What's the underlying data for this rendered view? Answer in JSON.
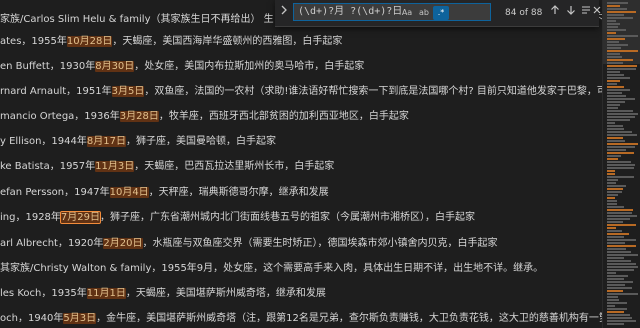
{
  "find_widget": {
    "toggle_icon": "chevron-right-icon",
    "query": "(\\d+)?月 ?(\\d+)?日",
    "match_case_label": "Aa",
    "whole_word_label": "ab",
    "regex_label": ".*",
    "match_count": "84 of 88",
    "prev_icon": "arrow-up-icon",
    "next_icon": "arrow-down-icon",
    "selection_icon": "list-selection-icon",
    "close_icon": "close-icon",
    "accent": "#0e639c"
  },
  "highlight_color": "#613214",
  "lines": [
    {
      "pre": "家族/Carlos Slim Helu & family（其家族生日不再给出） 生日：1940年",
      "hl": "1月28日",
      "post": "，水瓶座：出生地：墨西哥城，白手起家。（注明，下列其他富豪不再"
    },
    {
      "pre": "ates，1955年",
      "hl": "10月28日",
      "post": "，天蝎座，美国西海岸华盛顿州的西雅图，白手起家"
    },
    {
      "pre": "en Buffett，1930年",
      "hl": "8月30日",
      "post": "，处女座，美国内布拉斯加州的奥马哈市，白手起家"
    },
    {
      "pre": "rnard Arnault，1951年",
      "hl": "3月5日",
      "post": "，双鱼座，法国的一农村（求助!谁法语好帮忙搜索一下到底是法国哪个村? 目前只知道他发家于巴黎，可是并不生在巴黎"
    },
    {
      "pre": "mancio Ortega，1936年",
      "hl": "3月28日",
      "post": "，牧羊座，西班牙西北部贫困的加利西亚地区，白手起家"
    },
    {
      "pre": "y Ellison，1944年",
      "hl": "8月17日",
      "post": "，狮子座，美国曼哈顿，白手起家"
    },
    {
      "pre": "ke Batista，1957年",
      "hl": "11月3日",
      "post": "，天蝎座，巴西瓦拉达里斯州长市，白手起家"
    },
    {
      "pre": "efan Persson，1947年",
      "hl": "10月4日",
      "post": "，天秤座，瑞典斯德哥尔摩，继承和发展"
    },
    {
      "pre": "ing，1928年",
      "hl": "7月29日",
      "post": "，狮子座，广东省潮州城内北门街面线巷五号的祖家（今属潮州市湘桥区），白手起家"
    },
    {
      "pre": "arl Albrecht，1920年",
      "hl": "2月20日",
      "post": "，水瓶座与双鱼座交界（需要生时矫正），德国埃森市郊小镇舍内贝克，白手起家"
    },
    {
      "pre": "其家族/Christy Walton & family，1955年9月，处女座，这个需要高手来入肉，具体出生日期不详，出生地不详。继承。",
      "hl": "",
      "post": ""
    },
    {
      "pre": "les Koch，1935年",
      "hl": "11月1日",
      "post": "，天蝎座，美国堪萨斯州威奇塔，继承和发展"
    },
    {
      "pre": "och，1940年",
      "hl": "5月3日",
      "post": "，金牛座，美国堪萨斯州威奇塔（注，跟第12名是兄弟，查尔斯负责赚钱，大卫负责花钱，这大卫的慈善机构有一箩筐，被形容为美国最"
    }
  ]
}
